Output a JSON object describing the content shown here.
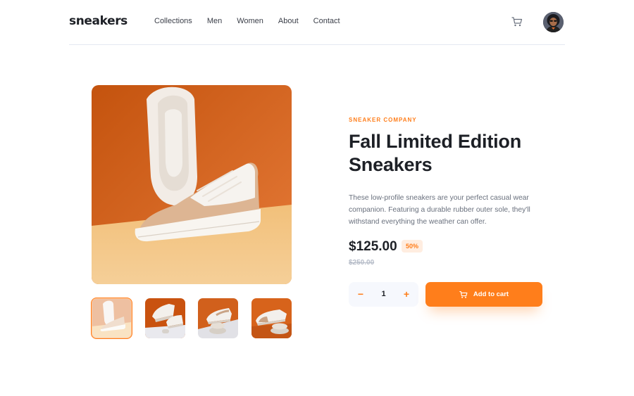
{
  "header": {
    "logo": "sneakers",
    "nav": [
      "Collections",
      "Men",
      "Women",
      "About",
      "Contact"
    ],
    "cart_icon": "cart-icon",
    "avatar": "user-avatar"
  },
  "gallery": {
    "thumbnails": [
      "thumbnail-1",
      "thumbnail-2",
      "thumbnail-3",
      "thumbnail-4"
    ],
    "active_thumbnail": 0
  },
  "product": {
    "company": "SNEAKER COMPANY",
    "title": "Fall Limited Edition Sneakers",
    "description": "These low-profile sneakers are your perfect casual wear companion. Featuring a durable rubber outer sole, they'll withstand everything the weather can offer.",
    "price": "$125.00",
    "discount": "50%",
    "original_price": "$250.00"
  },
  "quantity": {
    "minus": "−",
    "value": "1",
    "plus": "+"
  },
  "cart_button": {
    "label": "Add to cart",
    "icon": "cart-icon"
  },
  "colors": {
    "accent": "#ff7e1b",
    "accent_pale": "#ffede0",
    "text_dark": "#1d2026",
    "text_muted": "#69707d",
    "light_gray": "#f6f8fd"
  }
}
